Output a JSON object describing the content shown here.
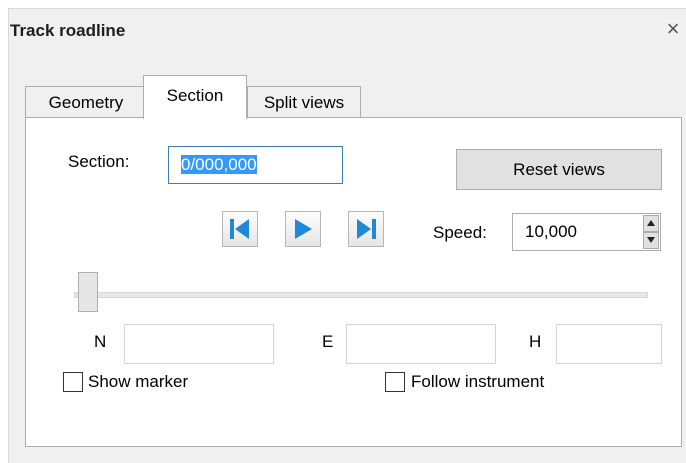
{
  "window": {
    "title": "Track roadline",
    "close_glyph": "×"
  },
  "tabs": [
    {
      "label": "Geometry",
      "active": false
    },
    {
      "label": "Section",
      "active": true
    },
    {
      "label": "Split views",
      "active": false
    }
  ],
  "section": {
    "label": "Section:",
    "value": "0/000,000"
  },
  "reset_button": {
    "label": "Reset views"
  },
  "playback": {
    "icons": [
      "skip-to-start-icon",
      "play-icon",
      "skip-to-end-icon"
    ],
    "color": "#1e88d9"
  },
  "speed": {
    "label": "Speed:",
    "value": "10,000"
  },
  "slider": {
    "position": 0
  },
  "coordinates": {
    "n_label": "N",
    "e_label": "E",
    "h_label": "H",
    "n_value": "",
    "e_value": "",
    "h_value": ""
  },
  "checkboxes": {
    "show_marker": {
      "label": "Show marker",
      "checked": false
    },
    "follow_instrument": {
      "label": "Follow instrument",
      "checked": false
    }
  }
}
